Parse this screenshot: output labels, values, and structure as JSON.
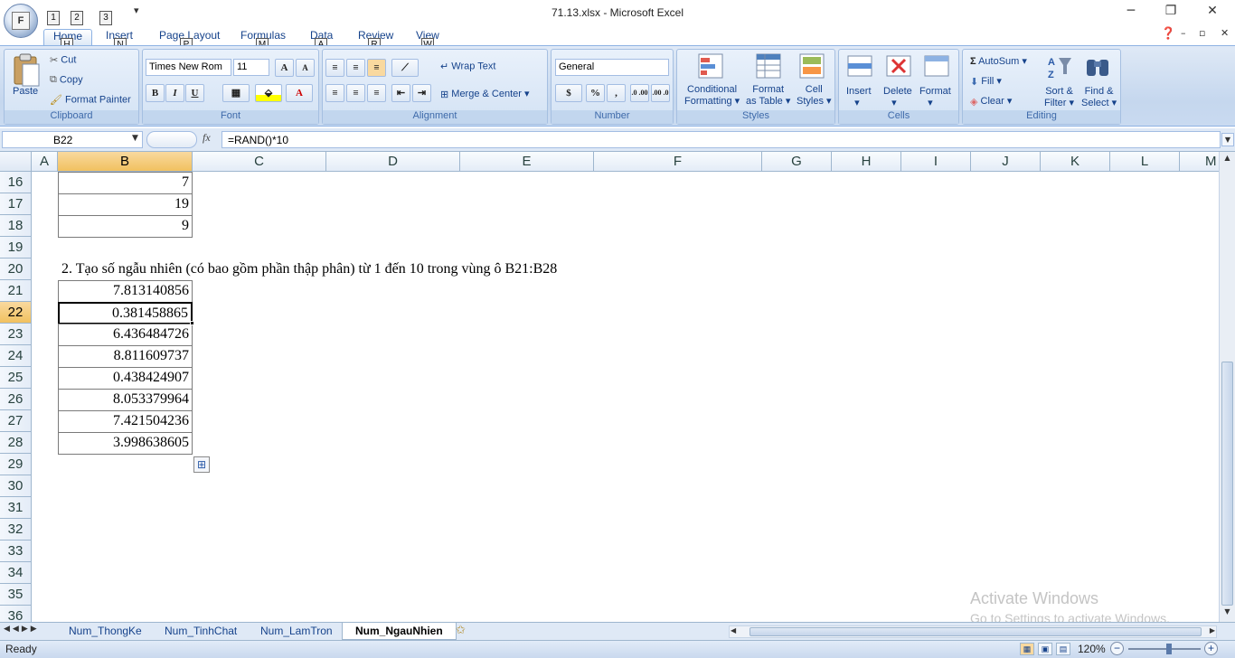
{
  "window": {
    "title": "71.13.xlsx - Microsoft Excel",
    "minimize": "─",
    "restore": "❐",
    "close": "✕"
  },
  "office_button": {
    "keytip": "F"
  },
  "qat": {
    "keytips": [
      "1",
      "2",
      "3"
    ],
    "more": "▾"
  },
  "tabs": [
    {
      "label": "Home",
      "keytip": "H"
    },
    {
      "label": "Insert",
      "keytip": "N"
    },
    {
      "label": "Page Layout",
      "keytip": "P"
    },
    {
      "label": "Formulas",
      "keytip": "M"
    },
    {
      "label": "Data",
      "keytip": "A"
    },
    {
      "label": "Review",
      "keytip": "R"
    },
    {
      "label": "View",
      "keytip": "W"
    }
  ],
  "ribbon": {
    "clipboard": {
      "label": "Clipboard",
      "paste": "Paste",
      "cut": "Cut",
      "copy": "Copy",
      "format_painter": "Format Painter"
    },
    "font": {
      "label": "Font",
      "name": "Times New Rom",
      "size": "11",
      "bold": "B",
      "italic": "I",
      "underline": "U",
      "grow": "A",
      "shrink": "A",
      "font_color": "A"
    },
    "alignment": {
      "label": "Alignment",
      "wrap_text": "Wrap Text",
      "merge_center": "Merge & Center"
    },
    "number": {
      "label": "Number",
      "format": "General",
      "percent": "%",
      "comma": ",",
      "inc_dec": ".0 .00",
      "dec_dec": ".00 .0"
    },
    "styles": {
      "label": "Styles",
      "conditional": [
        "Conditional",
        "Formatting"
      ],
      "format_table": [
        "Format",
        "as Table"
      ],
      "cell_styles": [
        "Cell",
        "Styles"
      ]
    },
    "cells": {
      "label": "Cells",
      "insert": "Insert",
      "delete": "Delete",
      "format": "Format"
    },
    "editing": {
      "label": "Editing",
      "autosum": "AutoSum",
      "fill": "Fill",
      "clear": "Clear",
      "sort_filter": [
        "Sort &",
        "Filter"
      ],
      "find_select": [
        "Find &",
        "Select"
      ]
    }
  },
  "formula_bar": {
    "name_box": "B22",
    "fx": "fx",
    "formula": "=RAND()*10"
  },
  "columns": [
    "A",
    "B",
    "C",
    "D",
    "E",
    "F",
    "G",
    "H",
    "I",
    "J",
    "K",
    "L",
    "M"
  ],
  "selected_column": "B",
  "rows": [
    "16",
    "17",
    "18",
    "19",
    "20",
    "21",
    "22",
    "23",
    "24",
    "25",
    "26",
    "27",
    "28",
    "29",
    "30",
    "31",
    "32",
    "33",
    "34",
    "35",
    "36"
  ],
  "selected_row": "22",
  "cells": {
    "b16": "7",
    "b17": "19",
    "b18": "9",
    "a20": "2. Tạo số ngẫu nhiên (có bao gồm phần thập phân) từ 1 đến 10 trong vùng ô B21:B28",
    "b21": "7.813140856",
    "b22": "0.381458865",
    "b23": "6.436484726",
    "b24": "8.811609737",
    "b25": "0.438424907",
    "b26": "8.053379964",
    "b27": "7.421504236",
    "b28": "3.998638605"
  },
  "sheets": [
    "Num_ThongKe",
    "Num_TinhChat",
    "Num_LamTron",
    "Num_NgauNhien"
  ],
  "active_sheet": "Num_NgauNhien",
  "status": {
    "ready": "Ready",
    "zoom": "120%"
  },
  "watermark": {
    "line1": "Activate Windows",
    "line2": "Go to Settings to activate Windows."
  }
}
